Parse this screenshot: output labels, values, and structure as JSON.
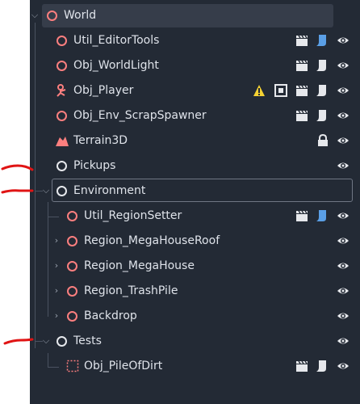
{
  "colors": {
    "panel_bg": "#232a35",
    "node_red": "#fc7f7f",
    "node_white": "#e6e8ec",
    "script_blue": "#5a9fe6",
    "warning_yellow": "#f5d233",
    "annotation_red": "#e01414"
  },
  "scene_tree": {
    "nodes": [
      {
        "label": "World",
        "icon": "node3d-icon",
        "expanded": true,
        "selected": true
      },
      {
        "label": "Util_EditorTools",
        "icon": "node3d-icon",
        "badges": [
          "clapperboard-icon",
          "script-icon-blue",
          "eye-icon"
        ]
      },
      {
        "label": "Obj_WorldLight",
        "icon": "node3d-icon",
        "badges": [
          "clapperboard-icon",
          "script-icon",
          "eye-icon"
        ]
      },
      {
        "label": "Obj_Player",
        "icon": "skeleton-icon",
        "badges": [
          "warning-icon",
          "camera-icon",
          "clapperboard-icon",
          "script-icon",
          "eye-icon"
        ]
      },
      {
        "label": "Obj_Env_ScrapSpawner",
        "icon": "node3d-icon",
        "badges": [
          "clapperboard-icon",
          "script-icon",
          "eye-icon"
        ]
      },
      {
        "label": "Terrain3D",
        "icon": "terrain-icon",
        "badges": [
          "lock-icon",
          "eye-icon"
        ]
      },
      {
        "label": "Pickups",
        "icon": "node-icon",
        "badges": [
          "eye-icon"
        ]
      },
      {
        "label": "Environment",
        "icon": "node-icon",
        "expanded": true,
        "focused": true
      },
      {
        "label": "Util_RegionSetter",
        "icon": "node3d-icon",
        "badges": [
          "clapperboard-icon",
          "script-icon-blue",
          "eye-icon"
        ]
      },
      {
        "label": "Region_MegaHouseRoof",
        "icon": "node3d-icon",
        "collapsed": true,
        "badges": [
          "eye-icon"
        ]
      },
      {
        "label": "Region_MegaHouse",
        "icon": "node3d-icon",
        "collapsed": true,
        "badges": [
          "eye-icon"
        ]
      },
      {
        "label": "Region_TrashPile",
        "icon": "node3d-icon",
        "collapsed": true,
        "badges": [
          "eye-icon"
        ]
      },
      {
        "label": "Backdrop",
        "icon": "node3d-icon",
        "collapsed": true,
        "badges": [
          "eye-icon"
        ]
      },
      {
        "label": "Tests",
        "icon": "node-icon",
        "expanded": true,
        "badges": [
          "eye-icon"
        ]
      },
      {
        "label": "Obj_PileOfDirt",
        "icon": "dotted-box-icon",
        "badges": [
          "clapperboard-icon",
          "script-icon",
          "eye-icon"
        ]
      }
    ]
  }
}
